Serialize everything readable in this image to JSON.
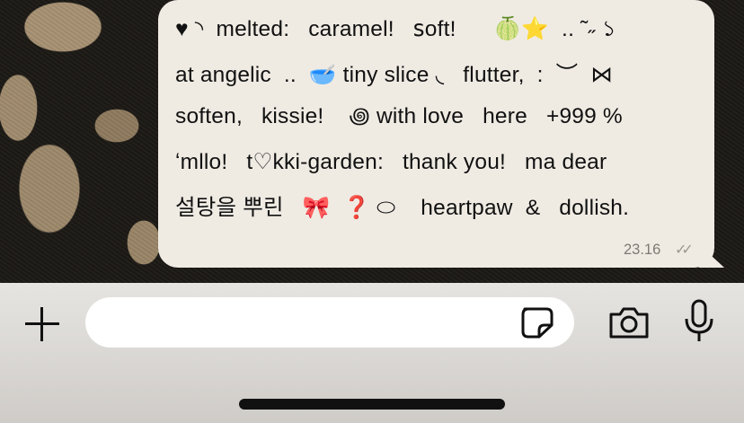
{
  "message": {
    "lines": [
      "♥ ◝  melted:   caramel!   ꜱoft!      🍈⭐  .. ˜˶ ১",
      "at angelic  ..  🥣 tiny slice ◟   flutter,  :  ︶  ⋈",
      "soften,   kissie!    ꩜ with love   here   +999 %",
      "ʻmllo!   t♡kki-garden:   thank you!   ma dear",
      "설탕을 뿌린   🎀  ❓ ⬭    heartpaw  &   dollish."
    ],
    "time": "23.16",
    "status_ticks": "✓✓"
  },
  "input": {
    "placeholder": "",
    "value": ""
  },
  "icons": {
    "plus": "plus-icon",
    "sticker": "sticker-icon",
    "camera": "camera-icon",
    "mic": "microphone-icon"
  },
  "colors": {
    "bubble": "#efebe3",
    "input_bar": "#e6e4e1",
    "text": "#111111",
    "meta": "#7d7a74"
  }
}
